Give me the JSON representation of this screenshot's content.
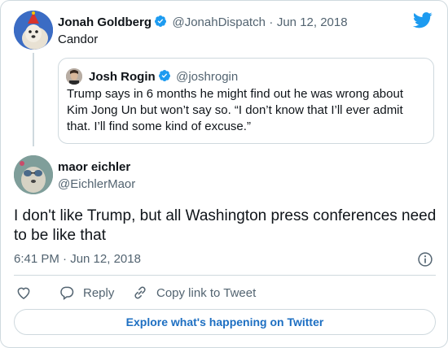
{
  "tweet": {
    "author_name": "Jonah Goldberg",
    "author_handle": "@JonahDispatch",
    "separator": "·",
    "date": "Jun 12, 2018",
    "text": "Candor"
  },
  "quoted_tweet": {
    "author_name": "Josh Rogin",
    "author_handle": "@joshrogin",
    "text": "Trump says in 6 months he might find out he was wrong about Kim Jong Un but won’t say so. “I don’t know that I’ll ever admit that. I’ll find some kind of excuse.”"
  },
  "reply": {
    "author_name": "maor eichler",
    "author_handle": "@EichlerMaor",
    "text": "I don't like Trump, but all Washington press conferences need to be like that",
    "timestamp": "6:41 PM · Jun 12, 2018"
  },
  "actions": {
    "reply_label": "Reply",
    "copy_link_label": "Copy link to Tweet"
  },
  "explore_label": "Explore what's happening on Twitter",
  "colors": {
    "twitter_blue": "#1d9bf0",
    "text": "#0f1419",
    "secondary_text": "#536471",
    "border": "#cfd9de",
    "link": "#1d6fc2"
  },
  "icons": [
    "twitter-logo-icon",
    "verified-badge-icon",
    "info-icon",
    "heart-icon",
    "reply-icon",
    "link-icon"
  ]
}
